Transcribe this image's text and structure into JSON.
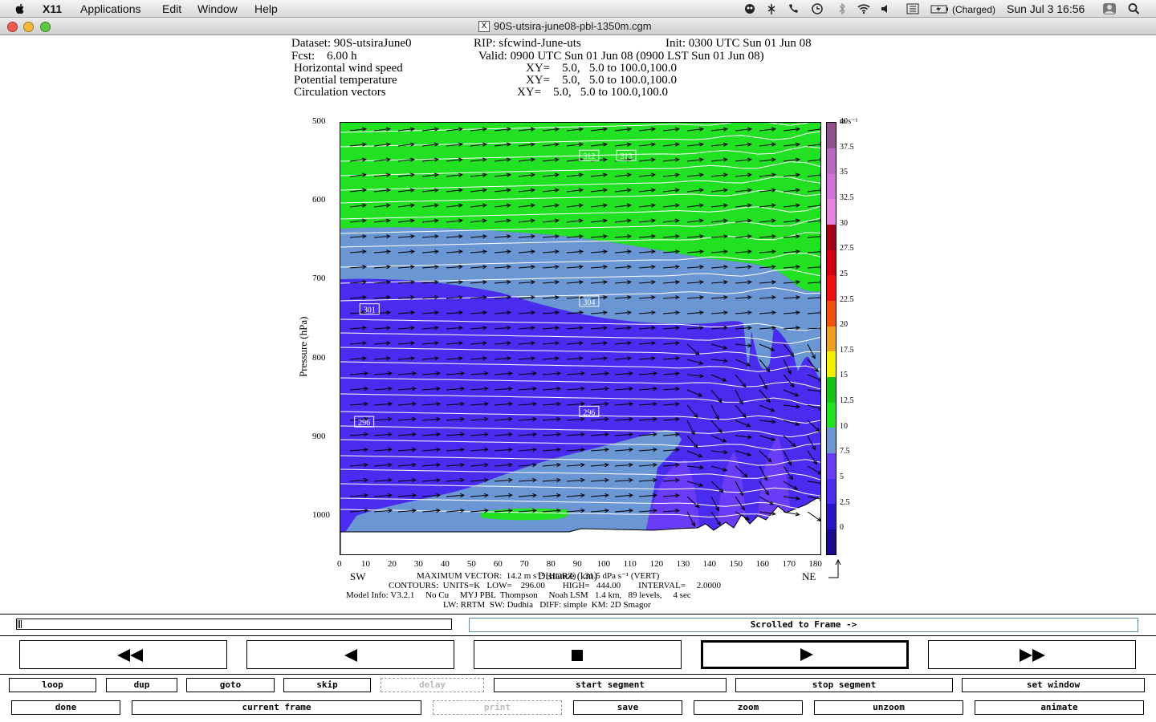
{
  "menubar": {
    "app_name": "X11",
    "menus": [
      "Applications",
      "Edit",
      "Window",
      "Help"
    ],
    "battery": "(Charged)",
    "clock": "Sun Jul 3  16:56"
  },
  "window": {
    "title": "90S-utsira-june08-pbl-1350m.cgm",
    "badge": "X"
  },
  "header": {
    "line1a": "Dataset: 90S-utsiraJune0",
    "line1b": "RIP: sfcwind-June-uts",
    "line1c": "Init: 0300 UTC Sun 01 Jun 08",
    "line2a": "Fcst:    6.00 h",
    "line2b": "Valid: 0900 UTC Sun 01 Jun 08 (0900 LST Sun 01 Jun 08)",
    "f1_name": "Horizontal wind speed",
    "f1_xy": "XY=    5.0,   5.0 to 100.0,100.0",
    "f2_name": "Potential temperature",
    "f2_xy": "XY=    5.0,   5.0 to 100.0,100.0",
    "f3_name": "Circulation vectors",
    "f3_xy": "XY=    5.0,   5.0 to 100.0,100.0"
  },
  "chart_data": {
    "type": "heatmap",
    "title": "",
    "xlabel": "Distance (km)",
    "ylabel": "Pressure (hPa)",
    "x_ticks": [
      0,
      10,
      20,
      30,
      40,
      50,
      60,
      70,
      80,
      90,
      100,
      110,
      120,
      130,
      140,
      150,
      160,
      170,
      180
    ],
    "y_ticks": [
      500,
      600,
      700,
      800,
      900,
      1000
    ],
    "xlim": [
      0,
      182
    ],
    "ylim": [
      1050,
      500
    ],
    "x_end_labels": {
      "left": "SW",
      "right": "NE"
    },
    "colorbar_unit": "m s⁻¹",
    "colorbar_levels": [
      0,
      2.5,
      5,
      7.5,
      10,
      12.5,
      15,
      17.5,
      20,
      22.5,
      25,
      27.5,
      30,
      32.5,
      35,
      37.5,
      40
    ],
    "colorbar_colors": [
      "#1a0a8c",
      "#2a14c8",
      "#4a2cf0",
      "#6a3cf8",
      "#6a96d4",
      "#22e022",
      "#16c416",
      "#f0f000",
      "#f0a020",
      "#f05010",
      "#f01010",
      "#d00010",
      "#a00018",
      "#e880e0",
      "#d070d8",
      "#b868c0",
      "#905090"
    ],
    "contour_labels": [
      {
        "value": "312",
        "x": 94,
        "p": 542
      },
      {
        "value": "313",
        "x": 108,
        "p": 542
      },
      {
        "value": "304",
        "x": 94,
        "p": 727
      },
      {
        "value": "301",
        "x": 11,
        "p": 737
      },
      {
        "value": "296",
        "x": 94,
        "p": 867
      },
      {
        "value": "296",
        "x": 9,
        "p": 880
      }
    ],
    "speed_regions": [
      {
        "name": "green-upper",
        "speed_range": "10-12.5"
      },
      {
        "name": "blue-middle",
        "speed_range": "7.5-10"
      },
      {
        "name": "purple-lower",
        "speed_range": "5-7.5"
      },
      {
        "name": "blue-lowlevel",
        "speed_range": "7.5-10"
      },
      {
        "name": "green-surface",
        "speed_range": "10-12.5"
      }
    ],
    "theta_contours": {
      "low": 296,
      "high": 444,
      "interval": 2,
      "units": "K"
    }
  },
  "footer": {
    "maxvec": "MAXIMUM VECTOR:  14.2 m s⁻¹ (HORZ)    31.5 dPa s⁻¹ (VERT)",
    "contours": "CONTOURS:  UNITS=K   LOW=    296.00        HIGH=   444.00        INTERVAL=     2.0000",
    "model": "Model Info: V3.2.1     No Cu     MYJ PBL  Thompson     Noah LSM   1.4 km,   89 levels,     4 sec",
    "physics": "LW: RRTM  SW: Dudhia   DIFF: simple  KM: 2D Smagor"
  },
  "controls": {
    "status": "Scrolled to Frame ->",
    "row1": [
      "loop",
      "dup",
      "goto",
      "skip",
      "delay",
      "start segment",
      "stop segment",
      "set window"
    ],
    "row2": [
      "done",
      "current frame",
      "print",
      "save",
      "zoom",
      "unzoom",
      "animate"
    ],
    "transport": [
      "rewind",
      "step-back",
      "stop",
      "play",
      "fast-forward"
    ]
  }
}
